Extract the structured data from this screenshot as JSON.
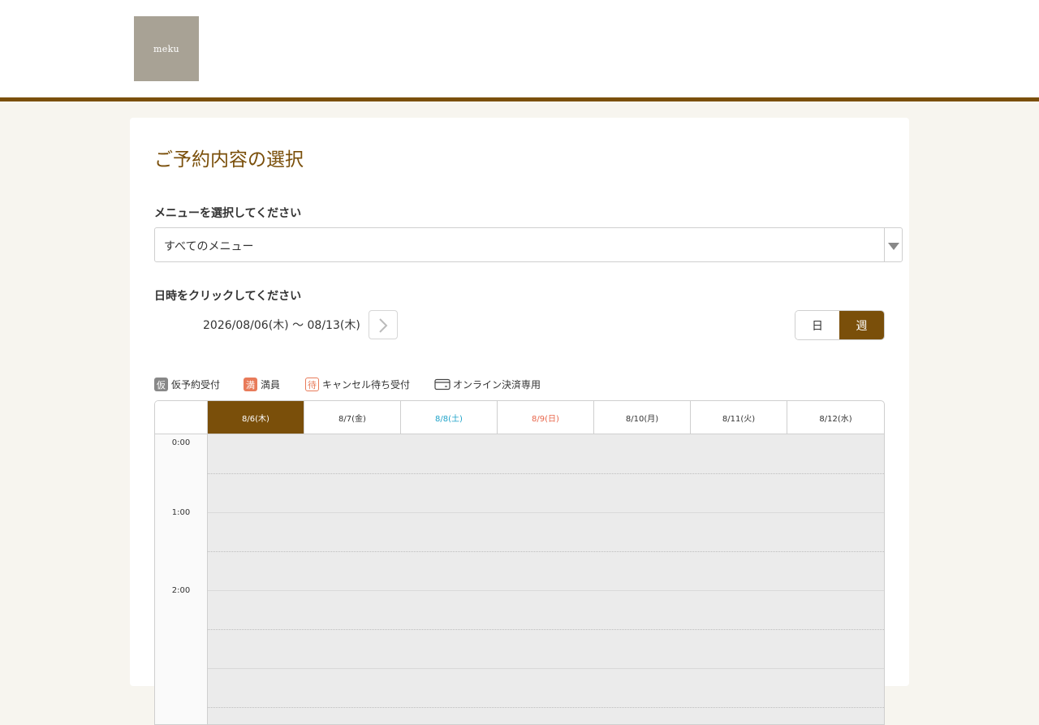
{
  "header": {
    "logo_text": "meku"
  },
  "page_title": "ご予約内容の選択",
  "menu": {
    "label": "メニューを選択してください",
    "selected": "すべてのメニュー"
  },
  "datetime": {
    "label": "日時をクリックしてください",
    "range": "2026/08/06(木) 〜 08/13(木)",
    "view_day": "日",
    "view_week": "週",
    "view_selected": "週"
  },
  "legend": {
    "kari_badge": "仮",
    "kari_label": "仮予約受付",
    "man_badge": "満",
    "man_label": "満員",
    "machi_badge": "待",
    "machi_label": "キャンセル待ち受付",
    "online_icon": "credit-card-icon",
    "online_label": "オンライン決済専用"
  },
  "calendar": {
    "days": [
      "8/6(木)",
      "8/7(金)",
      "8/8(土)",
      "8/9(日)",
      "8/10(月)",
      "8/11(火)",
      "8/12(水)"
    ],
    "times": [
      "0:00",
      "1:00",
      "2:00"
    ]
  },
  "colors": {
    "accent": "#7a4f0a",
    "saturday": "#1fa3c9",
    "sunday": "#e8654a",
    "badge_full": "#e87b5a"
  }
}
